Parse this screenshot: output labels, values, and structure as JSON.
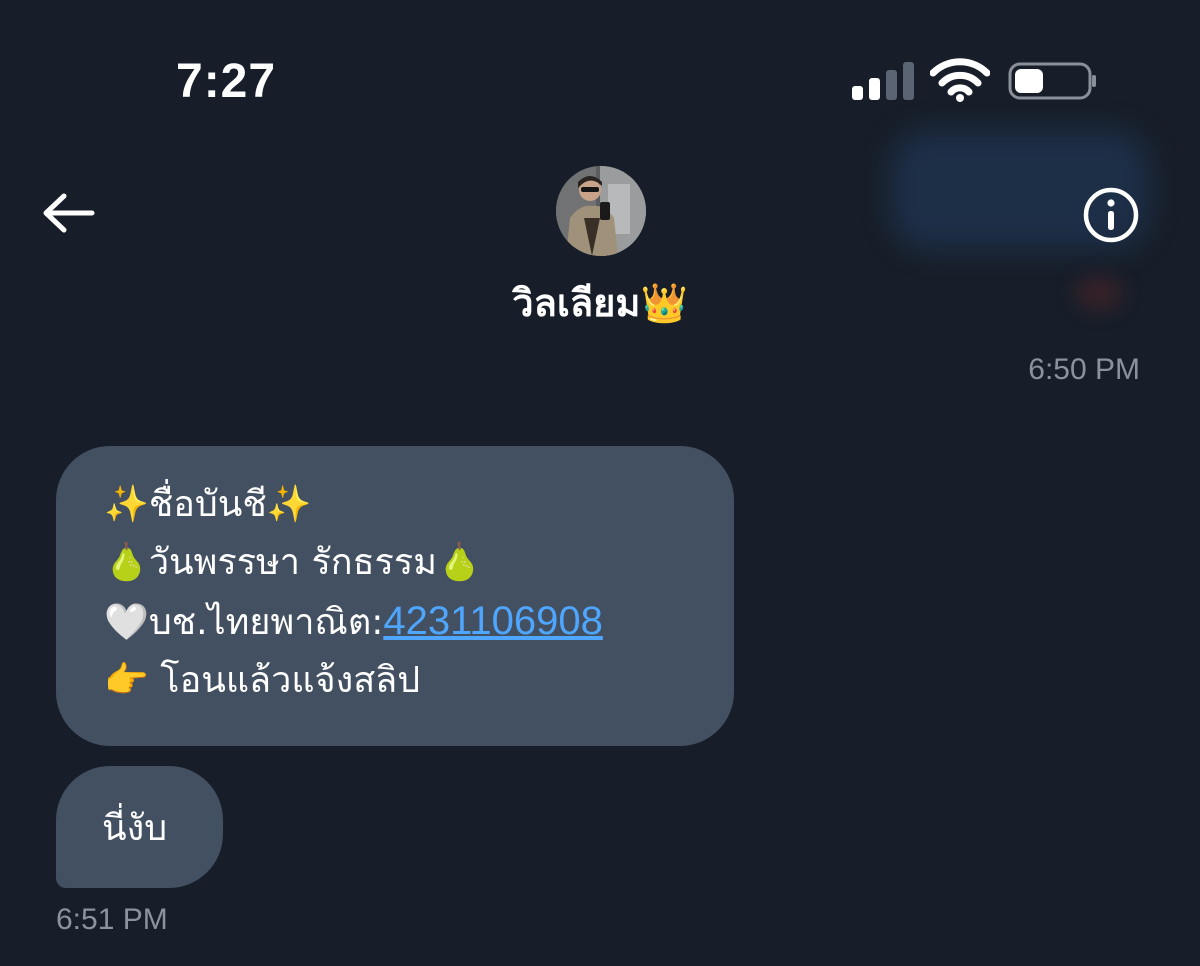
{
  "status_bar": {
    "time": "7:27",
    "signal_bars": 2,
    "signal_bars_total": 4,
    "battery_level": 0.4
  },
  "header": {
    "back_icon": "arrow-left-icon",
    "info_icon": "info-circle-icon",
    "contact_name": "วิลเลียม👑"
  },
  "messages": {
    "timestamp_top": "6:50 PM",
    "bubble1": {
      "line1": "✨ชื่อบันชี✨",
      "line2": "🍐วันพรรษา รักธรรม🍐",
      "line3_prefix": "🤍บช.ไทยพาณิต:",
      "line3_account": "4231106908",
      "line4": "👉 โอนแล้วแจ้งสลิป"
    },
    "bubble2": {
      "text": "นี่งับ"
    },
    "timestamp_bottom": "6:51 PM"
  },
  "colors": {
    "background": "#171e29",
    "bubble": "#435061",
    "link": "#4ea6ff",
    "timestamp": "#8b929c"
  }
}
